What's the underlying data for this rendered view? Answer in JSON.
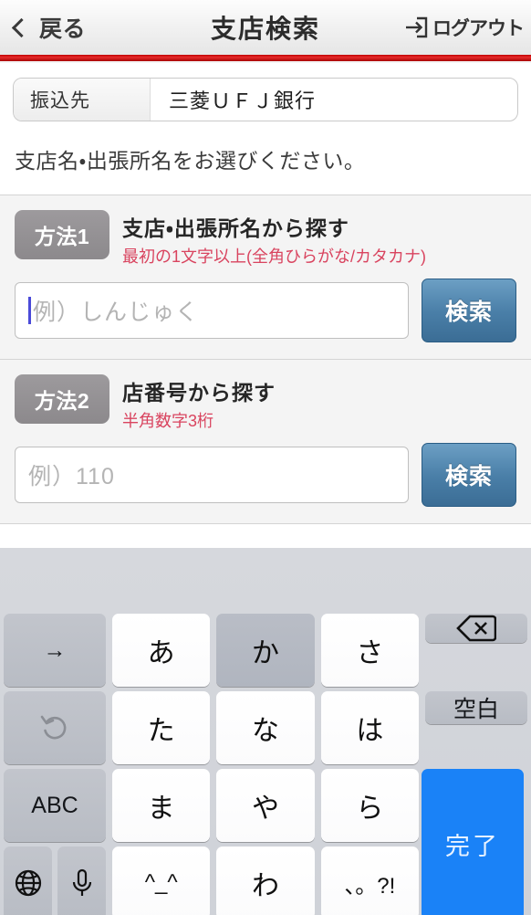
{
  "header": {
    "back_label": "戻る",
    "back_icon": "chevron-left-icon",
    "title": "支店検索",
    "logout_label": "ログアウト",
    "logout_icon": "logout-arrow-icon",
    "accent_rule_color": "#d81010"
  },
  "destination": {
    "label": "振込先",
    "value": "三菱ＵＦＪ銀行"
  },
  "instruction": "支店名・出張所名をお選びください。",
  "methods": [
    {
      "badge": "方法1",
      "title": "支店・出張所名から探す",
      "hint": "最初の1文字以上(全角ひらがな/カタカナ)",
      "hint_color": "#d9445f",
      "input_placeholder": "例）しんじゅく",
      "input_value": "",
      "focused": true,
      "search_label": "検索"
    },
    {
      "badge": "方法2",
      "title": "店番号から探す",
      "hint": "半角数字3桁",
      "hint_color": "#d9445f",
      "input_placeholder": "例）110",
      "input_value": "",
      "focused": false,
      "search_label": "検索"
    }
  ],
  "keyboard": {
    "type": "japanese-kana-12key",
    "accent_color": "#1a82f7",
    "candidate_bar_text": "",
    "rows": [
      {
        "left": {
          "label": "→",
          "name": "cursor-right-key"
        },
        "keys": [
          {
            "label": "あ",
            "name": "kana-key-a",
            "pressed": false
          },
          {
            "label": "か",
            "name": "kana-key-ka",
            "pressed": true
          },
          {
            "label": "さ",
            "name": "kana-key-sa",
            "pressed": false
          }
        ],
        "right": {
          "label": "⌫",
          "name": "backspace-key"
        }
      },
      {
        "left": {
          "label": "↺",
          "name": "undo-key"
        },
        "keys": [
          {
            "label": "た",
            "name": "kana-key-ta",
            "pressed": false
          },
          {
            "label": "な",
            "name": "kana-key-na",
            "pressed": false
          },
          {
            "label": "は",
            "name": "kana-key-ha",
            "pressed": false
          }
        ],
        "right": {
          "label": "空白",
          "name": "space-key"
        }
      },
      {
        "left": {
          "label": "ABC",
          "name": "abc-mode-key"
        },
        "keys": [
          {
            "label": "ま",
            "name": "kana-key-ma",
            "pressed": false
          },
          {
            "label": "や",
            "name": "kana-key-ya",
            "pressed": false
          },
          {
            "label": "ら",
            "name": "kana-key-ra",
            "pressed": false
          }
        ],
        "right": {
          "label": "完了",
          "name": "done-key"
        }
      },
      {
        "left": {
          "label": "globe",
          "name": "globe-key"
        },
        "left2": {
          "label": "mic",
          "name": "dictation-key"
        },
        "keys": [
          {
            "label": "^_^",
            "name": "emoticon-key",
            "pressed": false
          },
          {
            "label": "わ",
            "name": "kana-key-wa",
            "pressed": false
          },
          {
            "label": "、。?!",
            "name": "punctuation-key",
            "pressed": false
          }
        ]
      }
    ],
    "done_label": "完了"
  }
}
